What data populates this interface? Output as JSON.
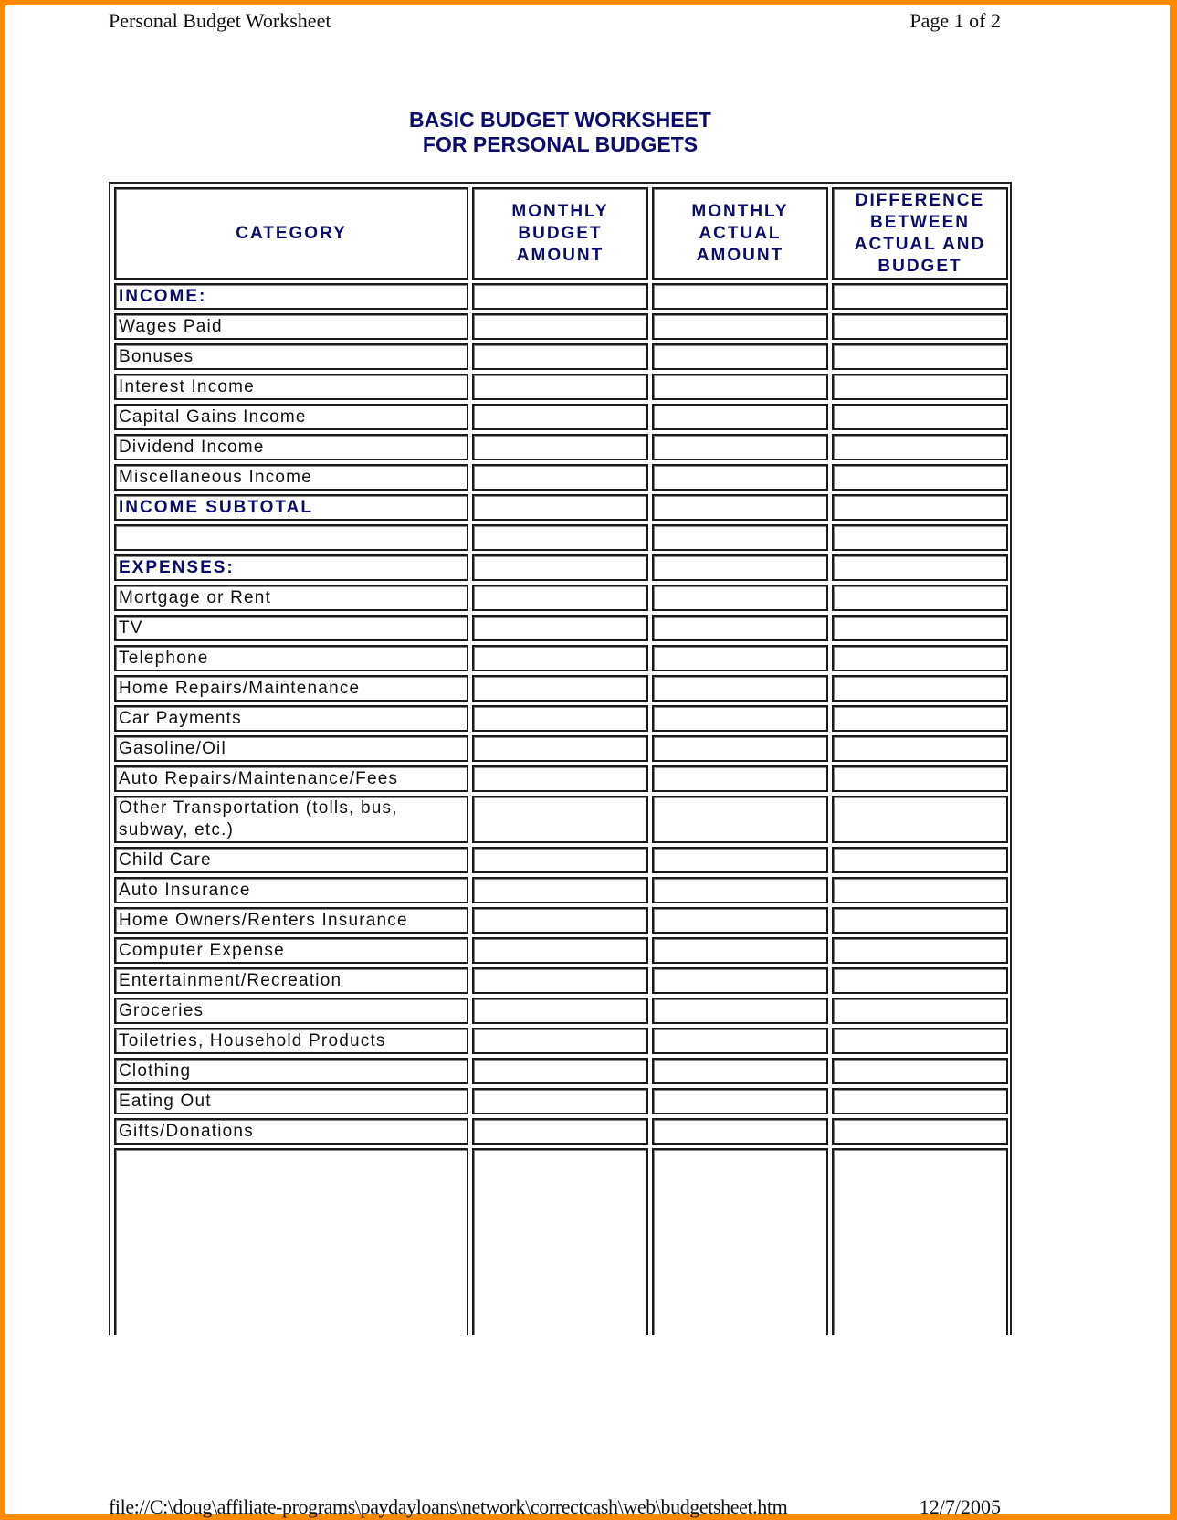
{
  "print_header": {
    "left": "Personal Budget Worksheet",
    "right": "Page 1 of 2"
  },
  "title": {
    "line1": "BASIC BUDGET WORKSHEET",
    "line2": "FOR PERSONAL BUDGETS"
  },
  "table": {
    "columns": [
      "CATEGORY",
      "MONTHLY BUDGET AMOUNT",
      "MONTHLY ACTUAL AMOUNT",
      "DIFFERENCE BETWEEN ACTUAL AND BUDGET"
    ],
    "rows": [
      {
        "category": "INCOME:",
        "type": "section",
        "budget": "",
        "actual": "",
        "difference": ""
      },
      {
        "category": "Wages Paid",
        "type": "item",
        "budget": "",
        "actual": "",
        "difference": ""
      },
      {
        "category": "Bonuses",
        "type": "item",
        "budget": "",
        "actual": "",
        "difference": ""
      },
      {
        "category": "Interest Income",
        "type": "item",
        "budget": "",
        "actual": "",
        "difference": ""
      },
      {
        "category": "Capital Gains Income",
        "type": "item",
        "budget": "",
        "actual": "",
        "difference": ""
      },
      {
        "category": "Dividend Income",
        "type": "item",
        "budget": "",
        "actual": "",
        "difference": ""
      },
      {
        "category": "Miscellaneous Income",
        "type": "item",
        "budget": "",
        "actual": "",
        "difference": ""
      },
      {
        "category": "INCOME SUBTOTAL",
        "type": "section",
        "budget": "",
        "actual": "",
        "difference": ""
      },
      {
        "category": "",
        "type": "blank",
        "budget": "",
        "actual": "",
        "difference": ""
      },
      {
        "category": "EXPENSES:",
        "type": "section",
        "budget": "",
        "actual": "",
        "difference": ""
      },
      {
        "category": "Mortgage or Rent",
        "type": "item",
        "budget": "",
        "actual": "",
        "difference": ""
      },
      {
        "category": "TV",
        "type": "item",
        "budget": "",
        "actual": "",
        "difference": ""
      },
      {
        "category": "Telephone",
        "type": "item",
        "budget": "",
        "actual": "",
        "difference": ""
      },
      {
        "category": "Home Repairs/Maintenance",
        "type": "item",
        "budget": "",
        "actual": "",
        "difference": ""
      },
      {
        "category": "Car Payments",
        "type": "item",
        "budget": "",
        "actual": "",
        "difference": ""
      },
      {
        "category": "Gasoline/Oil",
        "type": "item",
        "budget": "",
        "actual": "",
        "difference": ""
      },
      {
        "category": "Auto Repairs/Maintenance/Fees",
        "type": "item",
        "budget": "",
        "actual": "",
        "difference": ""
      },
      {
        "category": "Other Transportation (tolls, bus, subway, etc.)",
        "type": "tall",
        "budget": "",
        "actual": "",
        "difference": ""
      },
      {
        "category": "Child Care",
        "type": "item",
        "budget": "",
        "actual": "",
        "difference": ""
      },
      {
        "category": "Auto Insurance",
        "type": "item",
        "budget": "",
        "actual": "",
        "difference": ""
      },
      {
        "category": "Home Owners/Renters Insurance",
        "type": "item",
        "budget": "",
        "actual": "",
        "difference": ""
      },
      {
        "category": "Computer Expense",
        "type": "item",
        "budget": "",
        "actual": "",
        "difference": ""
      },
      {
        "category": "Entertainment/Recreation",
        "type": "item",
        "budget": "",
        "actual": "",
        "difference": ""
      },
      {
        "category": "Groceries",
        "type": "item",
        "budget": "",
        "actual": "",
        "difference": ""
      },
      {
        "category": "Toiletries, Household Products",
        "type": "item",
        "budget": "",
        "actual": "",
        "difference": ""
      },
      {
        "category": "Clothing",
        "type": "item",
        "budget": "",
        "actual": "",
        "difference": ""
      },
      {
        "category": "Eating Out",
        "type": "item",
        "budget": "",
        "actual": "",
        "difference": ""
      },
      {
        "category": "Gifts/Donations",
        "type": "item",
        "budget": "",
        "actual": "",
        "difference": ""
      },
      {
        "category": "",
        "type": "blank-tall",
        "budget": "",
        "actual": "",
        "difference": ""
      }
    ]
  },
  "print_footer": {
    "left": "file://C:\\doug\\affiliate-programs\\paydayloans\\network\\correctcash\\web\\budgetsheet.htm",
    "right": "12/7/2005"
  },
  "colors": {
    "frame": "#ff8a00",
    "heading": "#0c0c6a"
  }
}
